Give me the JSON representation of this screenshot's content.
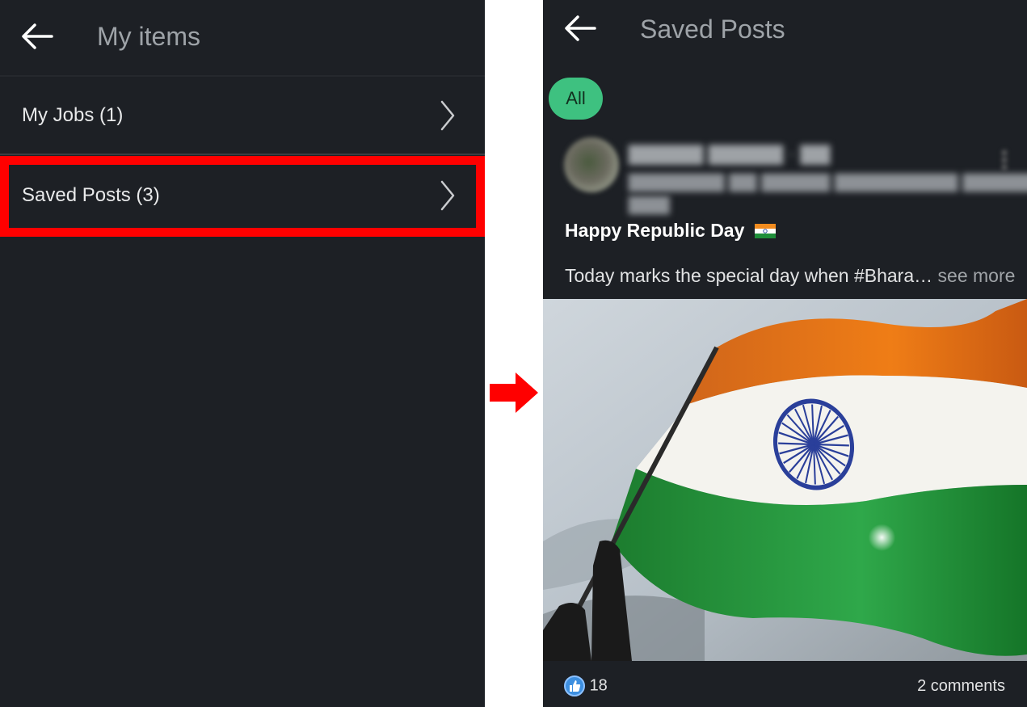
{
  "left_screen": {
    "title": "My items",
    "rows": [
      {
        "label": "My Jobs (1)"
      },
      {
        "label": "Saved Posts (3)"
      }
    ]
  },
  "right_screen": {
    "title": "Saved Posts",
    "filter_pill": "All",
    "post": {
      "title": "Happy Republic Day",
      "body": "Today marks the special day when #Bhara…",
      "see_more": "see more",
      "likes_count": "18",
      "comments": "2 comments"
    }
  },
  "colors": {
    "background": "#1d2025",
    "highlight": "#ff0000",
    "pill": "#3ec180"
  },
  "icons": [
    "back-arrow-icon",
    "chevron-right-icon",
    "red-arrow-icon",
    "like-icon",
    "more-icon"
  ]
}
